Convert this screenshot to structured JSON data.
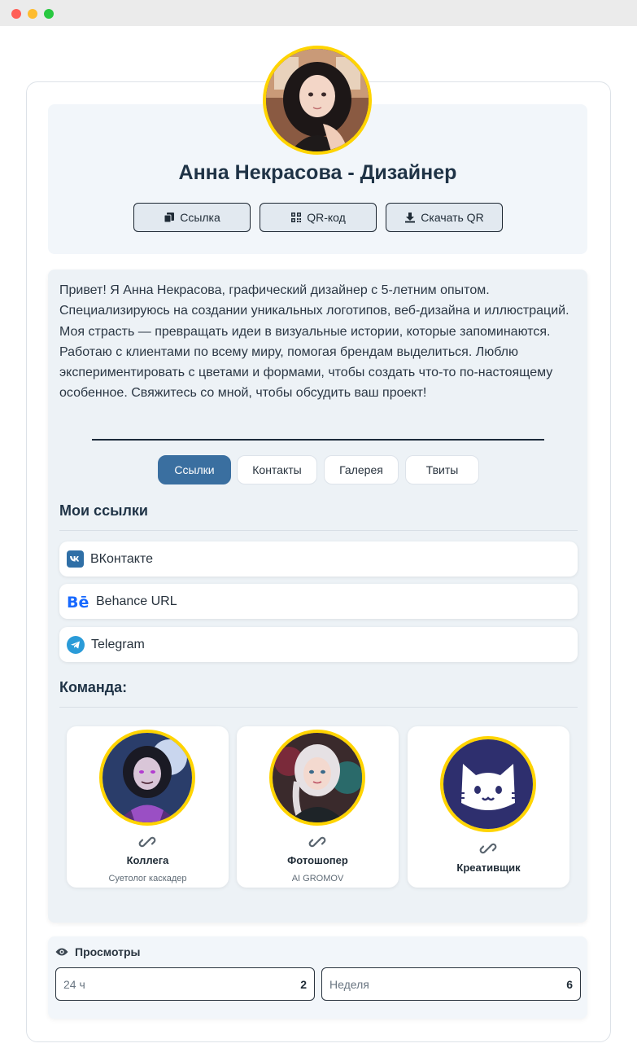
{
  "window": {
    "controls": [
      "close",
      "minimize",
      "maximize"
    ]
  },
  "profile": {
    "name": "Анна Некрасова - Дизайнер",
    "avatar_icon": "avatar-anna",
    "buttons": [
      {
        "label": "Ссылка",
        "icon": "copy-icon"
      },
      {
        "label": "QR-код",
        "icon": "qr-icon"
      },
      {
        "label": "Скачать QR",
        "icon": "download-icon"
      }
    ]
  },
  "bio": "Привет! Я Анна Некрасова, графический дизайнер с 5-летним опытом. Специализируюсь на создании уникальных логотипов, веб-дизайна и иллюстраций. Моя страсть — превращать идеи в визуальные истории, которые запоминаются. Работаю с клиентами по всему миру, помогая брендам выделиться. Люблю экспериментировать с цветами и формами, чтобы создать что-то по-настоящему особенное. Свяжитесь со мной, чтобы обсудить ваш проект!",
  "tabs": [
    {
      "label": "Ссылки",
      "active": true
    },
    {
      "label": "Контакты",
      "active": false
    },
    {
      "label": "Галерея",
      "active": false
    },
    {
      "label": "Твиты",
      "active": false
    }
  ],
  "links_section": {
    "title": "Мои ссылки",
    "items": [
      {
        "label": "ВКонтакте",
        "icon": "vk-icon"
      },
      {
        "label": "Behance URL",
        "icon": "behance-icon"
      },
      {
        "label": "Telegram",
        "icon": "telegram-icon"
      }
    ]
  },
  "team_section": {
    "title": "Команда:",
    "members": [
      {
        "role": "Коллега",
        "subtitle": "Суетолог каскадер"
      },
      {
        "role": "Фотошопер",
        "subtitle": "AI GROMOV"
      },
      {
        "role": "Креативщик",
        "subtitle": ""
      }
    ]
  },
  "views": {
    "title": "Просмотры",
    "stats": [
      {
        "label": "24 ч",
        "value": "2"
      },
      {
        "label": "Неделя",
        "value": "6"
      }
    ]
  },
  "colors": {
    "accent": "#3a6fa0",
    "avatar_border": "#ffd400"
  }
}
